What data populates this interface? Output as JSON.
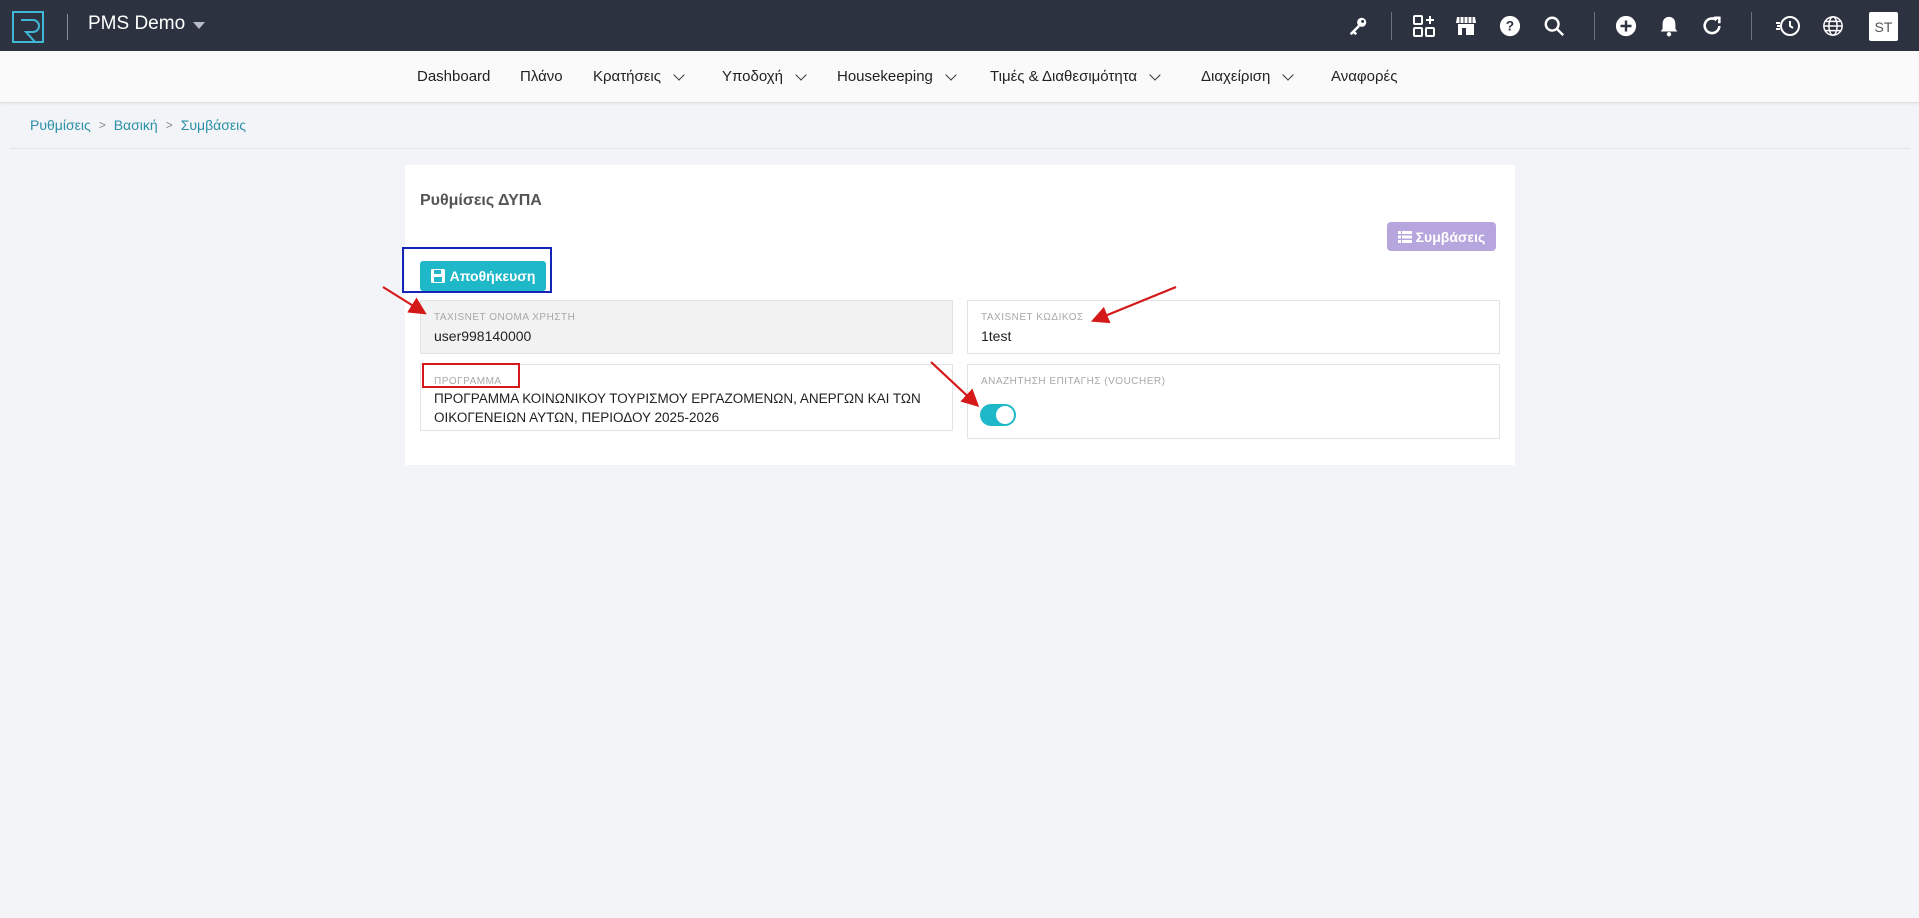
{
  "app": {
    "brand": "PMS Demo",
    "user_initials": "ST"
  },
  "topbar_icons": [
    "key-icon",
    "apps-add-icon",
    "store-icon",
    "help-icon",
    "search-icon",
    "plus-circle-icon",
    "bell-icon",
    "refresh-icon",
    "history-icon",
    "globe-icon"
  ],
  "nav": {
    "items": [
      {
        "label": "Dashboard",
        "has_menu": false
      },
      {
        "label": "Πλάνο",
        "has_menu": false
      },
      {
        "label": "Κρατήσεις",
        "has_menu": true
      },
      {
        "label": "Υποδοχή",
        "has_menu": true
      },
      {
        "label": "Housekeeping",
        "has_menu": true
      },
      {
        "label": "Τιμές & Διαθεσιμότητα",
        "has_menu": true
      },
      {
        "label": "Διαχείριση",
        "has_menu": true
      },
      {
        "label": "Αναφορές",
        "has_menu": false
      }
    ]
  },
  "breadcrumb": {
    "items": [
      "Ρυθμίσεις",
      "Βασική",
      "Συμβάσεις"
    ],
    "separator": ">"
  },
  "card": {
    "title": "Ρυθμίσεις ΔΥΠΑ",
    "contracts_button": "Συμβάσεις",
    "save_button": "Αποθήκευση"
  },
  "fields": {
    "username": {
      "label": "TAXISNET ΟΝΟΜΑ ΧΡΗΣΤΗ",
      "value": "user998140000"
    },
    "password": {
      "label": "TAXISNET ΚΩΔΙΚΟΣ",
      "value": "1test"
    },
    "program": {
      "label": "ΠΡΟΓΡΑΜΜΑ",
      "value": "ΠΡΟΓΡΑΜΜΑ ΚΟΙΝΩΝΙΚΟΥ ΤΟΥΡΙΣΜΟΥ ΕΡΓΑΖΟΜΕΝΩΝ, ΑΝΕΡΓΩΝ ΚΑΙ ΤΩΝ ΟΙΚΟΓΕΝΕΙΩΝ ΑΥΤΩΝ, ΠΕΡΙΟΔΟΥ 2025-2026"
    },
    "voucher_search": {
      "label": "ΑΝΑΖΗΤΗΣΗ ΕΠΙΤΑΓΗΣ (VOUCHER)",
      "enabled": true
    }
  },
  "colors": {
    "topbar": "#2d3241",
    "accent": "#1fb8c9",
    "contracts_button": "#b7a6dd",
    "breadcrumb_link": "#2a8fa8",
    "annotation_red": "#d51818",
    "annotation_blue": "#1525b8"
  }
}
